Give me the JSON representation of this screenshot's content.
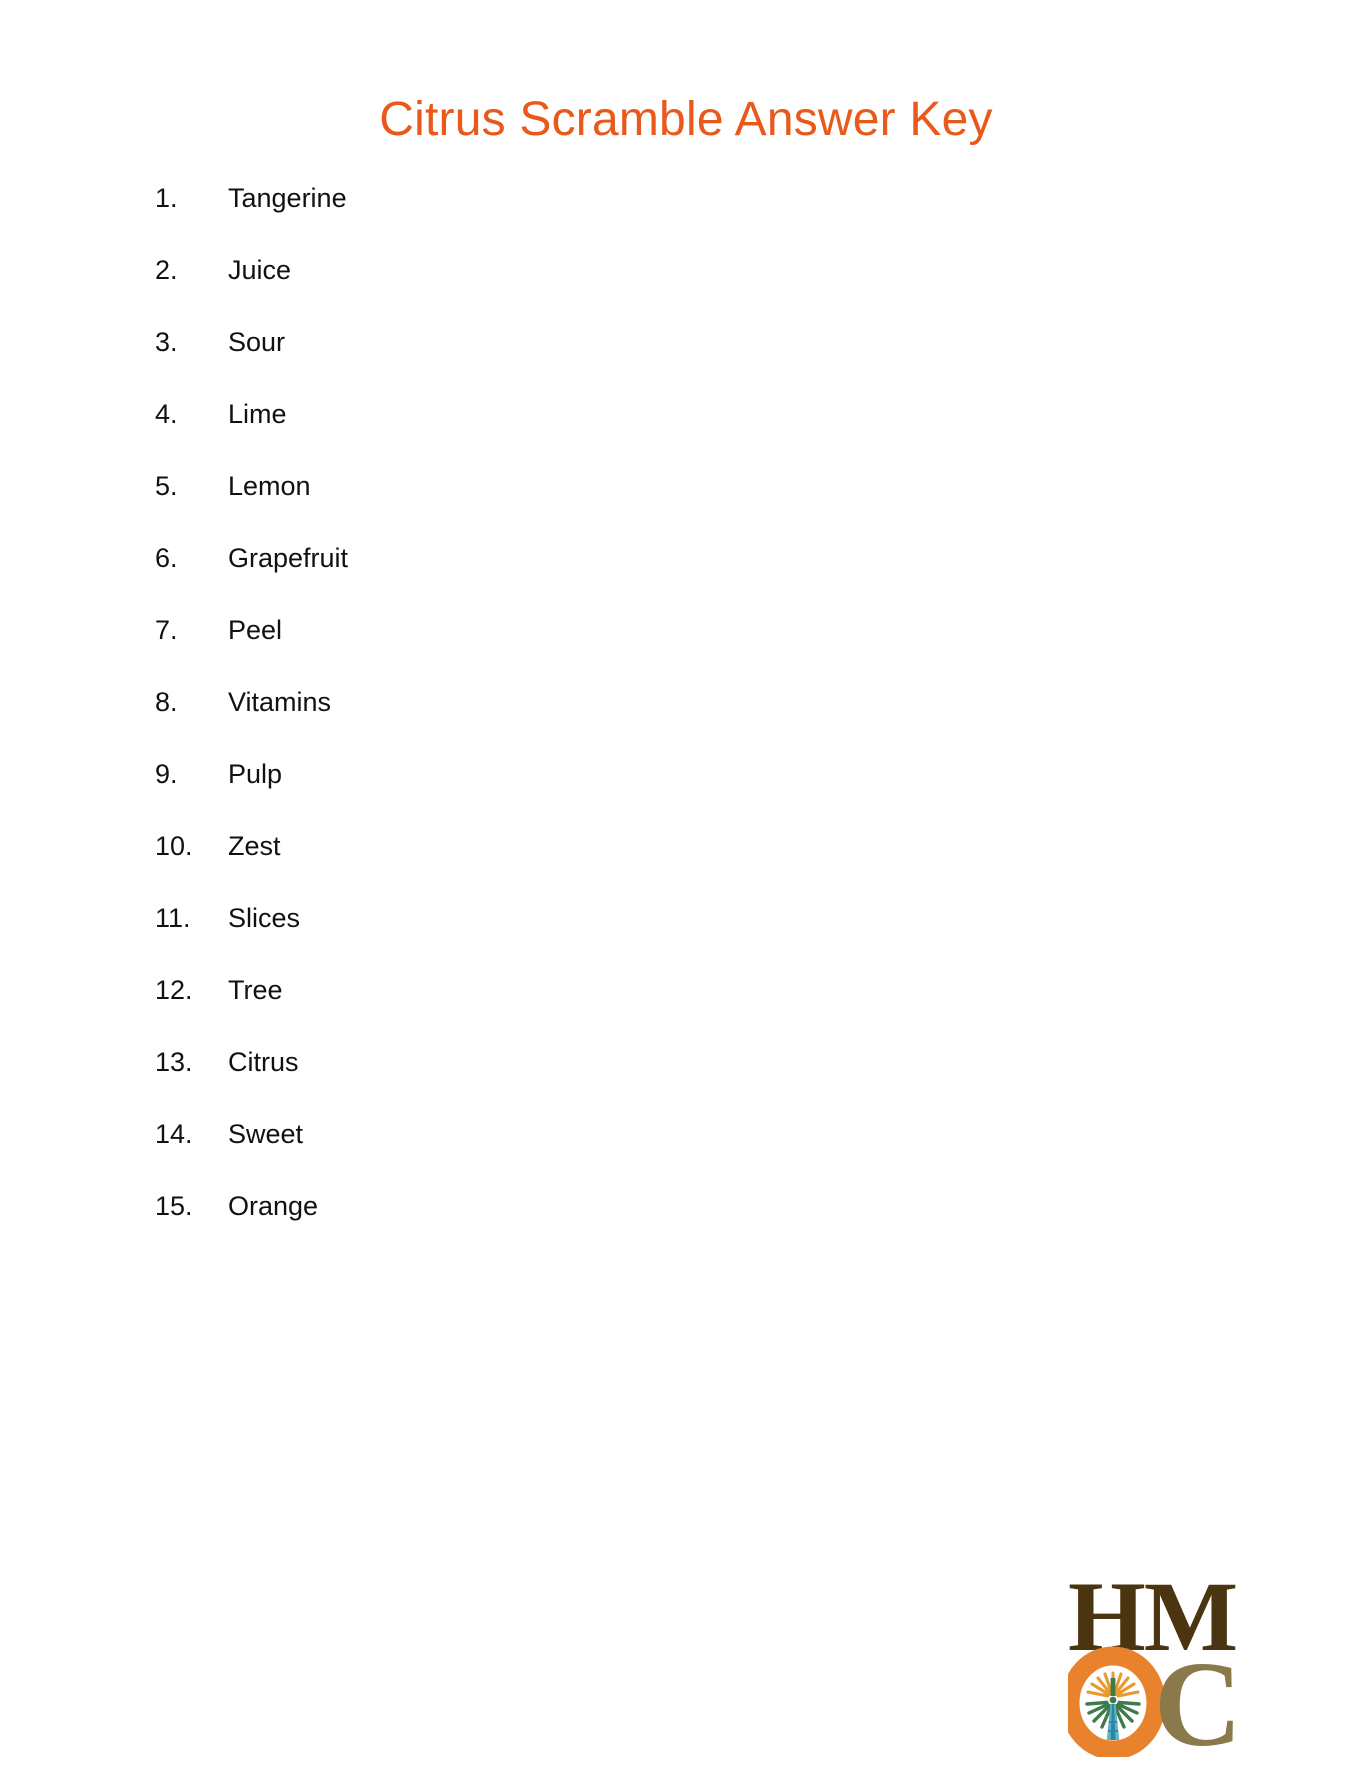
{
  "document": {
    "title": "Citrus Scramble Answer Key",
    "title_color": "#E8591A",
    "background_color": "#FFFFFF",
    "text_color": "#111111"
  },
  "answers": [
    {
      "number": "1.",
      "label": "Tangerine"
    },
    {
      "number": "2.",
      "label": "Juice"
    },
    {
      "number": "3.",
      "label": "Sour"
    },
    {
      "number": "4.",
      "label": "Lime"
    },
    {
      "number": "5.",
      "label": "Lemon"
    },
    {
      "number": "6.",
      "label": "Grapefruit"
    },
    {
      "number": "7.",
      "label": "Peel"
    },
    {
      "number": "8.",
      "label": "Vitamins"
    },
    {
      "number": "9.",
      "label": "Pulp"
    },
    {
      "number": "10.",
      "label": "Zest"
    },
    {
      "number": "11.",
      "label": "Slices"
    },
    {
      "number": "12.",
      "label": "Tree"
    },
    {
      "number": "13.",
      "label": "Citrus"
    },
    {
      "number": "14.",
      "label": "Sweet"
    },
    {
      "number": "15.",
      "label": "Orange"
    }
  ],
  "logo": {
    "line1": "HM",
    "line2_left": "O",
    "line2_right": "C",
    "hm_color": "#4A3510",
    "o_color": "#E8822C",
    "c_color": "#8A7A4B",
    "emblem_name": "windmill-emblem",
    "emblem_ray_color": "#E89A2C",
    "emblem_leaf_color": "#3F7A4A",
    "emblem_tower_color": "#5BB4C9"
  }
}
